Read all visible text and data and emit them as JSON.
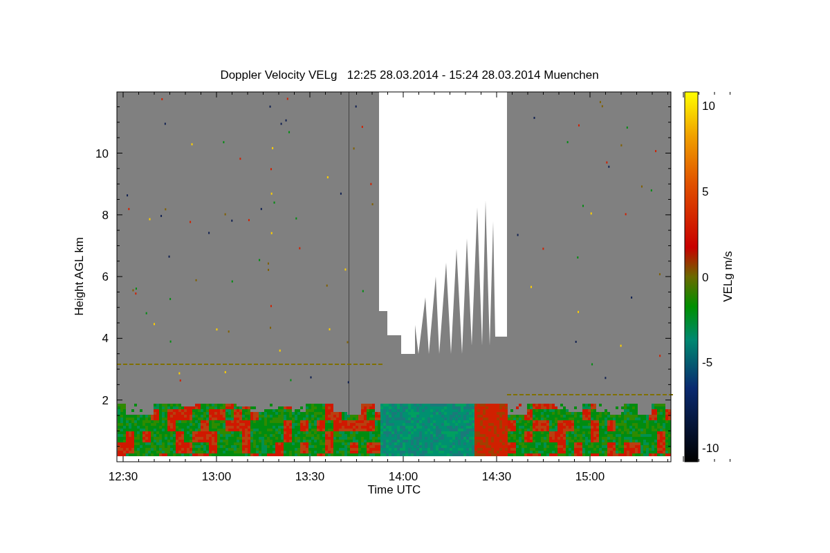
{
  "chart": {
    "title": "Doppler Velocity VELg   12:25 28.03.2014 - 15:24 28.03.2014 Muenchen",
    "y_axis_label": "Height AGL km",
    "y_tick_labels": [
      "10",
      "8",
      "6",
      "4",
      "2"
    ],
    "x_axis_label": "Time UTC",
    "x_tick_labels": [
      "12:30",
      "13:00",
      "13:30",
      "14:00",
      "14:30",
      "15:00"
    ]
  },
  "colorbar": {
    "label": "VELg m/s",
    "tick_labels": [
      "10",
      "5",
      "0",
      "-5",
      "-10"
    ]
  }
}
